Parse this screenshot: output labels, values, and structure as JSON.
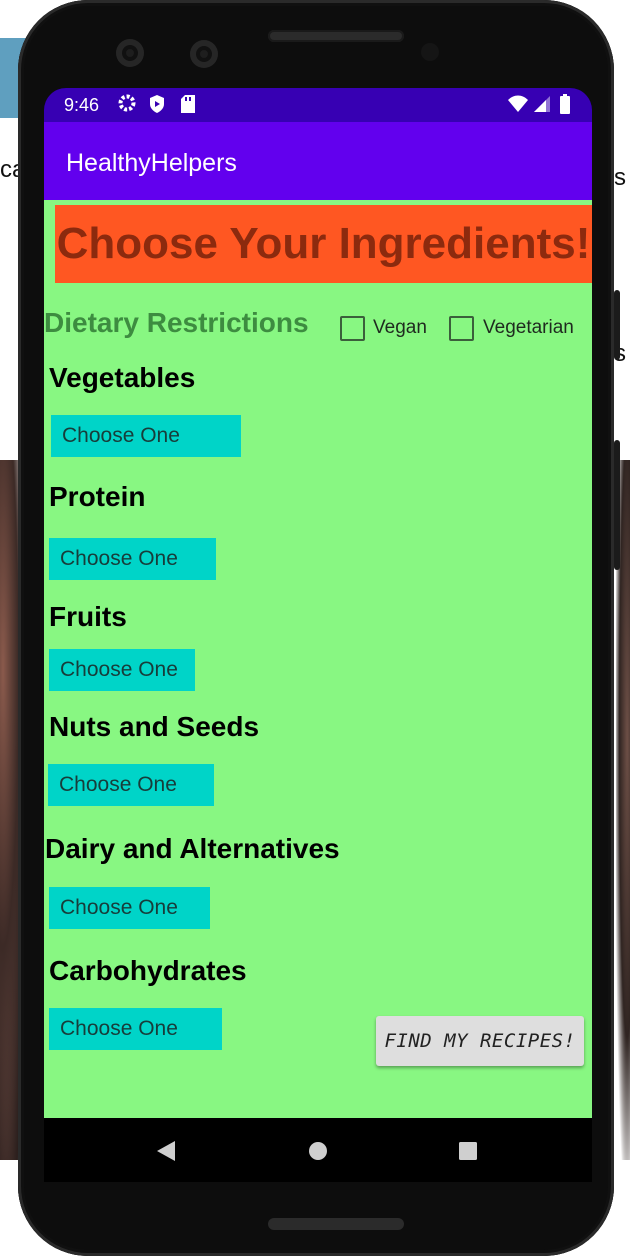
{
  "status_bar": {
    "time": "9:46"
  },
  "app_bar": {
    "title": "HealthyHelpers"
  },
  "header": {
    "banner": "Choose Your Ingredients!"
  },
  "dietary": {
    "label": "Dietary Restrictions",
    "options": [
      {
        "label": "Vegan",
        "checked": false
      },
      {
        "label": "Vegetarian",
        "checked": false
      }
    ]
  },
  "sections": [
    {
      "title": "Vegetables",
      "spinner": "Choose One"
    },
    {
      "title": "Protein",
      "spinner": "Choose One"
    },
    {
      "title": "Fruits",
      "spinner": "Choose One"
    },
    {
      "title": "Nuts and Seeds",
      "spinner": "Choose One"
    },
    {
      "title": "Dairy and Alternatives",
      "spinner": "Choose One"
    },
    {
      "title": "Carbohydrates",
      "spinner": "Choose One"
    }
  ],
  "actions": {
    "find_recipes": "FIND MY RECIPES!"
  },
  "colors": {
    "status_bar": "#3700b3",
    "app_bar": "#6200ee",
    "content_bg": "#88f782",
    "banner_bg": "#ff5722",
    "banner_text": "#8c2a0e",
    "spinner_bg": "#00d4c8",
    "dietary_label": "#3d8c40"
  }
}
